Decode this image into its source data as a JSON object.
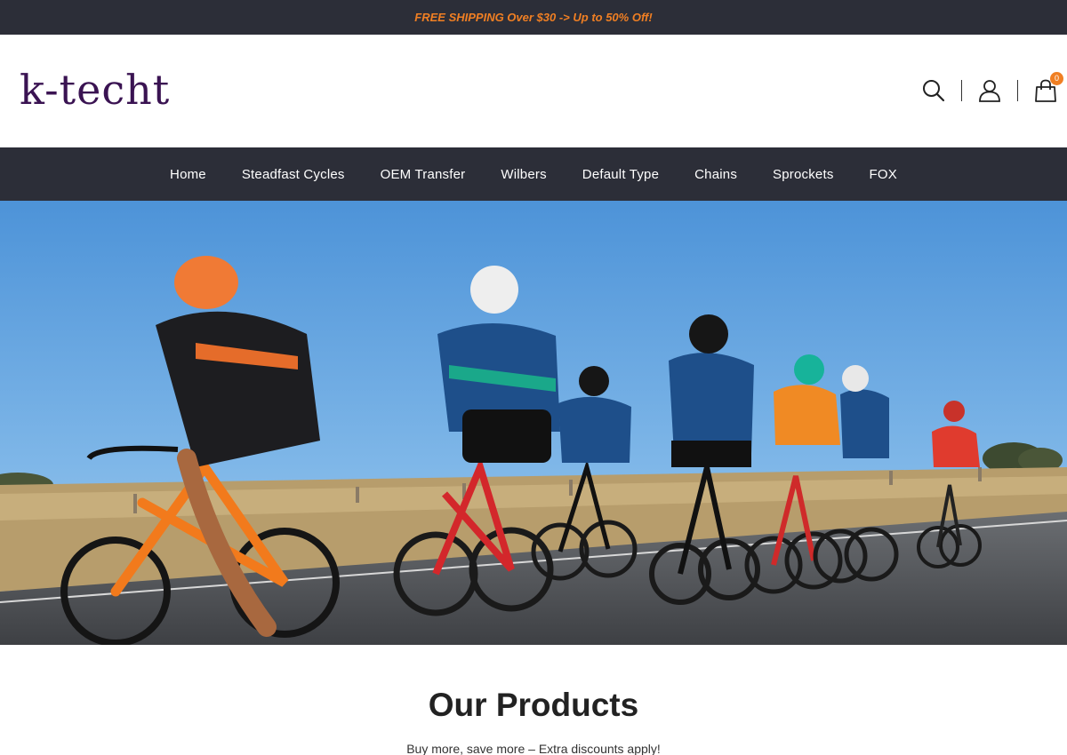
{
  "announcement": {
    "text": "FREE SHIPPING Over $30 -> Up to 50% Off!"
  },
  "header": {
    "logo_text": "k-techt",
    "icons": [
      "search-icon",
      "account-icon",
      "cart-icon"
    ],
    "cart_count": "0"
  },
  "nav": {
    "items": [
      {
        "label": "Home"
      },
      {
        "label": "Steadfast Cycles"
      },
      {
        "label": "OEM Transfer"
      },
      {
        "label": "Wilbers"
      },
      {
        "label": "Default Type"
      },
      {
        "label": "Chains"
      },
      {
        "label": "Sprockets"
      },
      {
        "label": "FOX"
      }
    ]
  },
  "products": {
    "title": "Our Products",
    "subtitle": "Buy more, save more – Extra discounts apply!"
  },
  "colors": {
    "topbar_bg": "#2c2e38",
    "accent": "#f07f23",
    "logo": "#3a1352"
  }
}
